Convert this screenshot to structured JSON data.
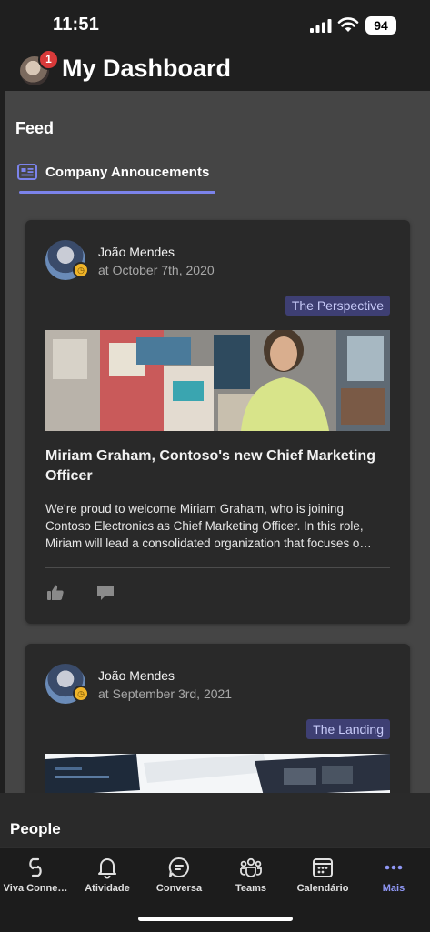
{
  "status": {
    "time": "11:51",
    "battery": "94"
  },
  "header": {
    "notification_count": "1",
    "title": "My Dashboard"
  },
  "feed": {
    "title": "Feed",
    "tab": "Company Annoucements",
    "posts": [
      {
        "author": "João Mendes",
        "date": "at October 7th, 2020",
        "source": "The Perspective",
        "title": "Miriam Graham, Contoso's new Chief Marketing Officer",
        "excerpt": "We’re proud to welcome Miriam Graham, who is joining Contoso Electronics as Chief Marketing Officer. In this role, Miriam will lead a consolidated organization that focuses o…"
      },
      {
        "author": "João Mendes",
        "date": "at September 3rd, 2021",
        "source": "The Landing"
      }
    ]
  },
  "people": {
    "title": "People"
  },
  "nav": {
    "items": [
      {
        "label": "Viva Conne…",
        "icon": "viva-connections-icon"
      },
      {
        "label": "Atividade",
        "icon": "bell-icon"
      },
      {
        "label": "Conversa",
        "icon": "chat-icon"
      },
      {
        "label": "Teams",
        "icon": "teams-icon"
      },
      {
        "label": "Calendário",
        "icon": "calendar-icon"
      },
      {
        "label": "Mais",
        "icon": "more-icon"
      }
    ],
    "active": "Mais",
    "accent": "#8f97f5"
  }
}
